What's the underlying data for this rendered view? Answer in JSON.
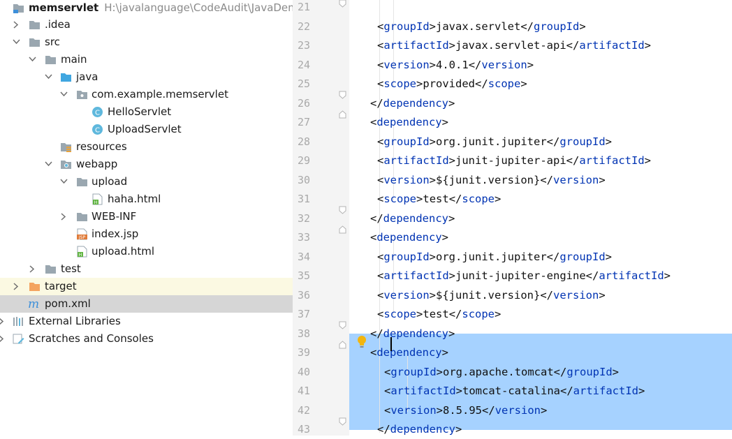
{
  "project_tree": {
    "root": {
      "name": "memservlet",
      "path": "H:\\javalanguage\\CodeAudit\\JavaDemo"
    },
    "items": [
      {
        "label": "memservlet",
        "kind": "module",
        "expanded": true
      },
      {
        "label": ".idea",
        "kind": "folder",
        "expanded": false
      },
      {
        "label": "src",
        "kind": "folder",
        "expanded": true
      },
      {
        "label": "main",
        "kind": "folder",
        "expanded": true
      },
      {
        "label": "java",
        "kind": "source-folder",
        "expanded": true
      },
      {
        "label": "com.example.memservlet",
        "kind": "package",
        "expanded": true
      },
      {
        "label": "HelloServlet",
        "kind": "class"
      },
      {
        "label": "UploadServlet",
        "kind": "class"
      },
      {
        "label": "resources",
        "kind": "resources-folder"
      },
      {
        "label": "webapp",
        "kind": "web-folder",
        "expanded": true
      },
      {
        "label": "upload",
        "kind": "folder",
        "expanded": true
      },
      {
        "label": "haha.html",
        "kind": "html-file"
      },
      {
        "label": "WEB-INF",
        "kind": "folder",
        "expanded": false
      },
      {
        "label": "index.jsp",
        "kind": "jsp-file"
      },
      {
        "label": "upload.html",
        "kind": "html-file"
      },
      {
        "label": "test",
        "kind": "folder",
        "expanded": false
      },
      {
        "label": "target",
        "kind": "excluded-folder",
        "expanded": false
      },
      {
        "label": "pom.xml",
        "kind": "maven-file",
        "selected": true
      },
      {
        "label": "External Libraries",
        "kind": "libraries",
        "expanded": false
      },
      {
        "label": "Scratches and Consoles",
        "kind": "scratches",
        "expanded": false
      }
    ]
  },
  "editor": {
    "lines": [
      {
        "number": "21",
        "text": ""
      },
      {
        "number": "22",
        "text": "<groupId>javax.servlet</groupId>"
      },
      {
        "number": "23",
        "text": "<artifactId>javax.servlet-api</artifactId>"
      },
      {
        "number": "24",
        "text": "<version>4.0.1</version>"
      },
      {
        "number": "25",
        "text": "<scope>provided</scope>"
      },
      {
        "number": "26",
        "text": "</dependency>"
      },
      {
        "number": "27",
        "text": "<dependency>"
      },
      {
        "number": "28",
        "text": "<groupId>org.junit.jupiter</groupId>"
      },
      {
        "number": "29",
        "text": "<artifactId>junit-jupiter-api</artifactId>"
      },
      {
        "number": "30",
        "text": "<version>${junit.version}</version>"
      },
      {
        "number": "31",
        "text": "<scope>test</scope>"
      },
      {
        "number": "32",
        "text": "</dependency>"
      },
      {
        "number": "33",
        "text": "<dependency>"
      },
      {
        "number": "34",
        "text": "<groupId>org.junit.jupiter</groupId>"
      },
      {
        "number": "35",
        "text": "<artifactId>junit-jupiter-engine</artifactId>"
      },
      {
        "number": "36",
        "text": "<version>${junit.version}</version>"
      },
      {
        "number": "37",
        "text": "<scope>test</scope>"
      },
      {
        "number": "38",
        "text": "</dependency>"
      },
      {
        "number": "39",
        "text": "<dependency>"
      },
      {
        "number": "40",
        "text": "<groupId>org.apache.tomcat</groupId>"
      },
      {
        "number": "41",
        "text": "<artifactId>tomcat-catalina</artifactId>"
      },
      {
        "number": "42",
        "text": "<version>8.5.95</version>"
      },
      {
        "number": "43",
        "text": "</dependency>"
      }
    ],
    "colors": {
      "tag": "#0033b3",
      "text": "#111111",
      "selection": "#a6d2ff",
      "gutter": "#f4f4f4",
      "line_number": "#a9a9a9"
    },
    "intention_icon": "lightbulb-icon"
  }
}
